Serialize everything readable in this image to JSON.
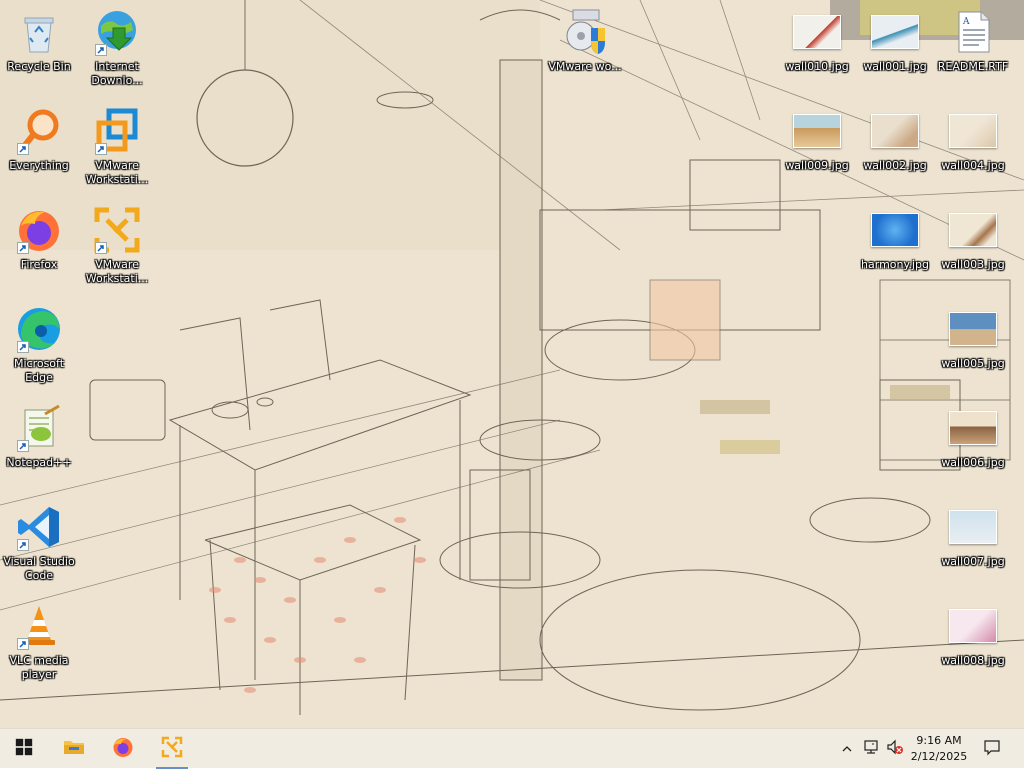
{
  "desktop": {
    "left_icons": [
      {
        "name": "recycle-bin",
        "label": "Recycle Bin",
        "icon": "recycle-bin-icon"
      },
      {
        "name": "everything",
        "label": "Everything",
        "icon": "magnifier-icon"
      },
      {
        "name": "firefox",
        "label": "Firefox",
        "icon": "firefox-icon"
      },
      {
        "name": "microsoft-edge",
        "label": "Microsoft Edge",
        "icon": "edge-icon"
      },
      {
        "name": "notepad-plus-plus",
        "label": "Notepad++",
        "icon": "notepad-plus-plus-icon"
      },
      {
        "name": "visual-studio-code",
        "label": "Visual Studio Code",
        "icon": "vscode-icon"
      },
      {
        "name": "vlc-media-player",
        "label": "VLC media player",
        "icon": "vlc-cone-icon"
      }
    ],
    "second_column_icons": [
      {
        "name": "internet-download-manager",
        "label": "Internet Downlo...",
        "icon": "idm-globe-icon"
      },
      {
        "name": "vmware-workstation-1",
        "label": "VMware Workstati...",
        "icon": "vmware-workstation-icon"
      },
      {
        "name": "vmware-workstation-2",
        "label": "VMware Workstati...",
        "icon": "vmware-player-icon"
      }
    ],
    "center_icon": {
      "name": "vmware-installer",
      "label": "VMware wo...",
      "icon": "vmware-installer-icon"
    },
    "right_icons": [
      {
        "name": "wall010",
        "label": "wall010.jpg",
        "icon": "image-thumbnail-icon",
        "colors": [
          "#f2f0ea",
          "#c0392b"
        ]
      },
      {
        "name": "wall001",
        "label": "wall001.jpg",
        "icon": "image-thumbnail-icon",
        "colors": [
          "#e8eef2",
          "#3c8fb5"
        ]
      },
      {
        "name": "readme",
        "label": "README.RTF",
        "icon": "rtf-document-icon"
      },
      {
        "name": "wall009",
        "label": "wall009.jpg",
        "icon": "image-thumbnail-icon",
        "colors": [
          "#b7d4de",
          "#c99a5d"
        ]
      },
      {
        "name": "wall002",
        "label": "wall002.jpg",
        "icon": "image-thumbnail-icon",
        "colors": [
          "#e9dfcc",
          "#cba886"
        ]
      },
      {
        "name": "wall004",
        "label": "wall004.jpg",
        "icon": "image-thumbnail-icon",
        "colors": [
          "#f0e6d6",
          "#dbc7a8"
        ]
      },
      {
        "name": "harmony",
        "label": "harmony.jpg",
        "icon": "image-thumbnail-icon",
        "colors": [
          "#1f6fcf",
          "#5fb3f0"
        ]
      },
      {
        "name": "wall003",
        "label": "wall003.jpg",
        "icon": "image-thumbnail-icon",
        "colors": [
          "#efe6d4",
          "#a6764c"
        ]
      },
      {
        "name": "wall005",
        "label": "wall005.jpg",
        "icon": "image-thumbnail-icon",
        "colors": [
          "#5d8fc1",
          "#d2b48c"
        ]
      },
      {
        "name": "wall006",
        "label": "wall006.jpg",
        "icon": "image-thumbnail-icon",
        "colors": [
          "#efe2cd",
          "#8a6242"
        ]
      },
      {
        "name": "wall007",
        "label": "wall007.jpg",
        "icon": "image-thumbnail-icon",
        "colors": [
          "#cfe2ee",
          "#e9eef2"
        ]
      },
      {
        "name": "wall008",
        "label": "wall008.jpg",
        "icon": "image-thumbnail-icon",
        "colors": [
          "#f6e8ee",
          "#d58aa8"
        ]
      }
    ]
  },
  "taskbar": {
    "start_icon": "windows-logo-icon",
    "pinned": [
      {
        "name": "file-explorer",
        "icon": "folder-icon"
      },
      {
        "name": "firefox",
        "icon": "firefox-icon"
      },
      {
        "name": "vmware",
        "icon": "vmware-player-icon",
        "active": true
      }
    ],
    "tray": {
      "chevron_icon": "chevron-up-icon",
      "network_icon": "network-icon",
      "volume_icon": "volume-muted-icon",
      "notification_icon": "notification-icon"
    },
    "clock": {
      "time": "9:16 AM",
      "date": "2/12/2025"
    }
  },
  "colors": {
    "wallpaper_base": "#ece2cf",
    "taskbar_bg": "#f0ece1",
    "accent": "#6a8fc7"
  }
}
